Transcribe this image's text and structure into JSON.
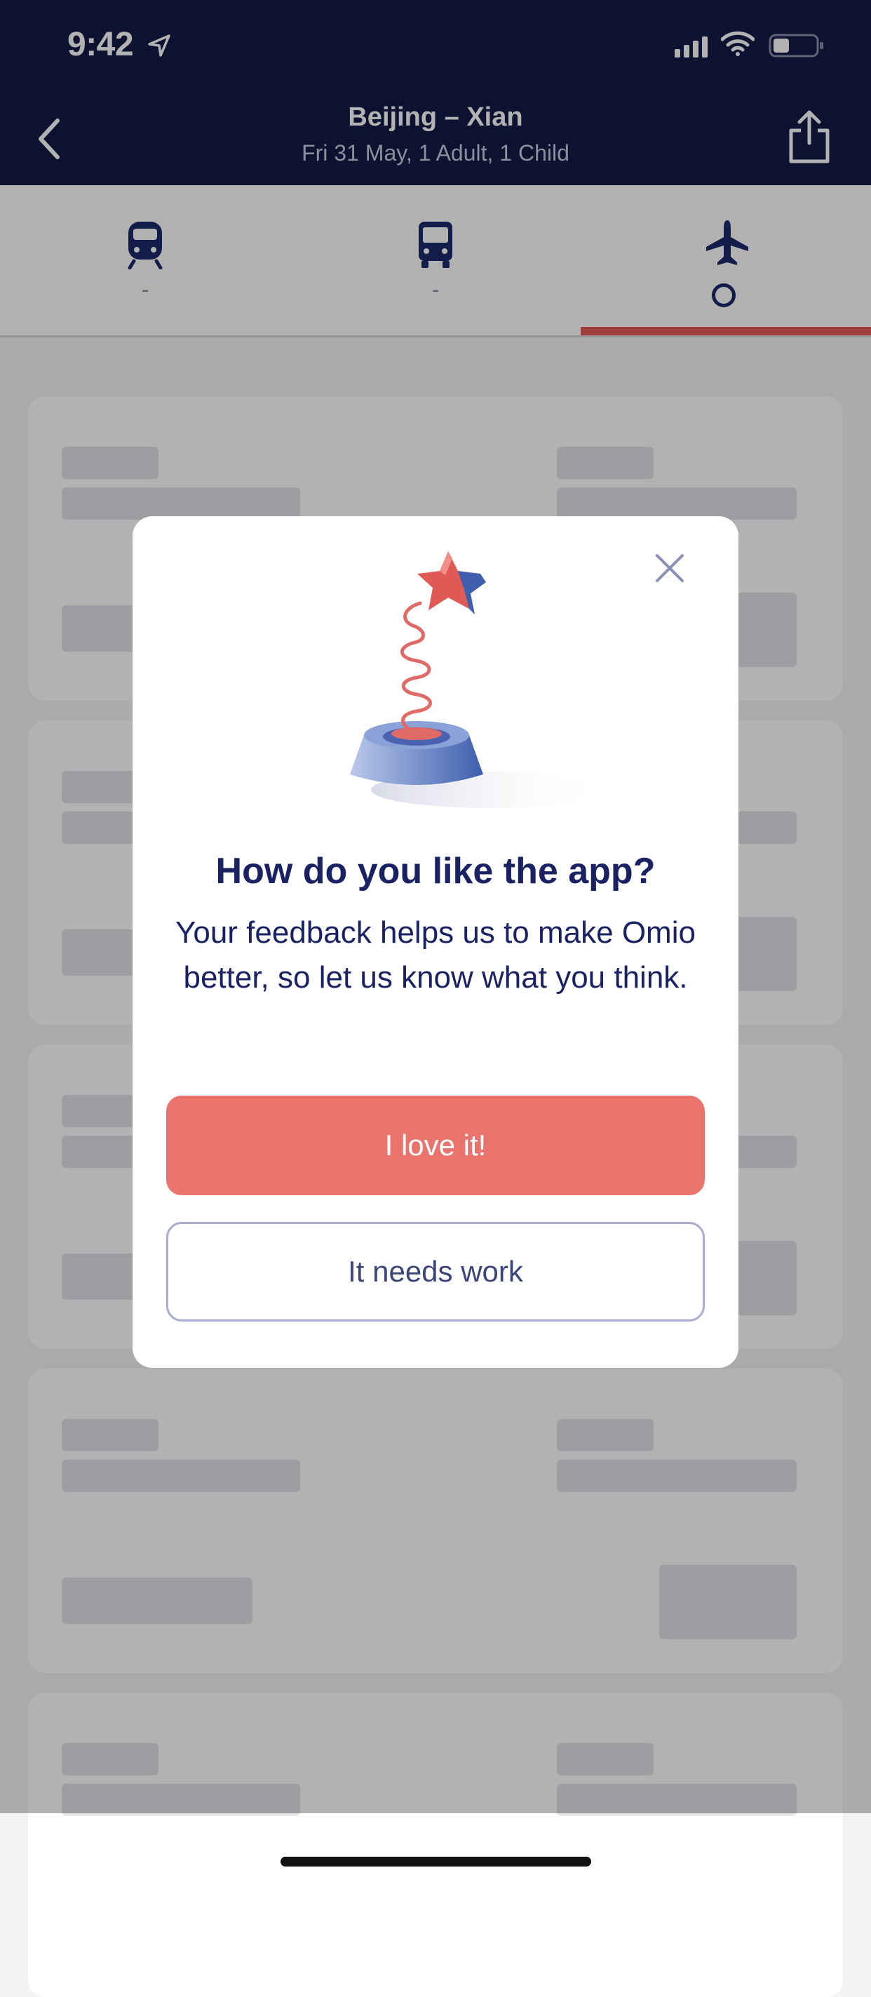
{
  "colors": {
    "navy": "#121a46",
    "coral": "#ea736e",
    "tab_indicator": "#e35a55",
    "dialog_text": "#1a2263"
  },
  "status_bar": {
    "time": "9:42",
    "icons": [
      "location-arrow-icon",
      "signal-icon",
      "wifi-icon",
      "battery-icon"
    ]
  },
  "header": {
    "title": "Beijing – Xian",
    "subtitle": "Fri 31 May, 1 Adult, 1 Child",
    "back_icon": "chevron-left-icon",
    "share_icon": "share-icon"
  },
  "tabs": [
    {
      "icon": "train-icon",
      "value": "-",
      "selected": false
    },
    {
      "icon": "bus-icon",
      "value": "-",
      "selected": false
    },
    {
      "icon": "plane-icon",
      "value": "",
      "selected": true,
      "loading": true
    }
  ],
  "dialog": {
    "title": "How do you like the app?",
    "body": "Your feedback helps us to make Omio better, so let us know what you think.",
    "primary_button": "I love it!",
    "secondary_button": "It needs work",
    "close_icon": "close-icon",
    "illustration": "star-spring-illustration"
  }
}
